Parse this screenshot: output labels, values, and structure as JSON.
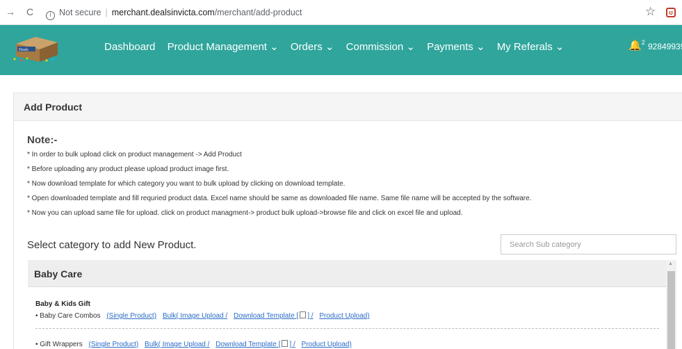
{
  "browser": {
    "back": "→",
    "reload": "C",
    "info_icon": "i",
    "not_secure": "Not secure",
    "url_host": "merchant.dealsinvicta.com",
    "url_path": "/merchant/add-product",
    "star": "☆",
    "extension": "ʊ"
  },
  "logo_text": "Deals",
  "nav": {
    "items": [
      "Dashboard",
      "Product Management ⌄",
      "Orders ⌄",
      "Commission ⌄",
      "Payments ⌄",
      "My Referals ⌄"
    ],
    "notification_count": "2",
    "phone": "92849939"
  },
  "panel": {
    "title": "Add Product",
    "note_title": "Note:-",
    "notes": [
      "* In order to bulk upload click on product management -> Add Product",
      "* Before uploading any product please upload product image first.",
      "* Now download template for which category you want to bulk upload by clicking on download template.",
      "* Open downloaded template and fill requried product data. Excel name should be same as downloaded file name. Same file name will be accepted by the software.",
      "* Now you can upload same file for upload. click on product managment-> product bulk upload->browse file and click on excel file and upload."
    ],
    "select_title": "Select category to add New Product.",
    "search_placeholder": "Search Sub category",
    "category": "Baby Care",
    "subcategory": "Baby & Kids Gift",
    "items": [
      {
        "name": "• Baby Care Combos",
        "single": "(Single Product)",
        "bulk": "Bulk( Image Upload /",
        "template": "Download Template [",
        "template_end": "] /",
        "upload": "Product Upload)"
      },
      {
        "name": "• Gift Wrappers",
        "single": "(Single Product)",
        "bulk": "Bulk( Image Upload /",
        "template": "Download Template [",
        "template_end": "] /",
        "upload": "Product Upload)"
      }
    ]
  },
  "colors": {
    "nav_bg": "#2fa59c",
    "link": "#2a6cc8"
  }
}
